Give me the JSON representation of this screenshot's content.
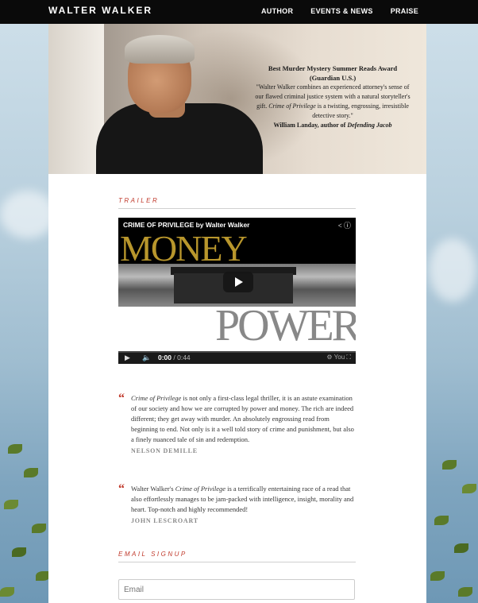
{
  "brand": "WALTER WALKER",
  "nav": [
    "AUTHOR",
    "EVENTS & NEWS",
    "PRAISE"
  ],
  "hero": {
    "award": "Best Murder Mystery Summer Reads Award (Guardian U.S.)",
    "quote_pre": "\"Walter Walker combines an experienced attorney's sense of our flawed criminal justice system with a natural storyteller's gift. ",
    "quote_book": "Crime of Privilege",
    "quote_post": " is a twisting, engrossing, irresistible detective story.\"",
    "attribution_pre": "William Landay, author of ",
    "attribution_book": "Defending Jacob"
  },
  "trailer": {
    "section_title": "TRAILER",
    "video_title": "CRIME OF PRIVILEGE by Walter Walker",
    "word_top": "MONEY",
    "word_bottom": "POWER",
    "time_current": "0:00",
    "time_sep": " / ",
    "time_total": "0:44",
    "progress": 0
  },
  "testimonials": [
    {
      "book": "Crime of Privilege",
      "text": " is not only a first-class legal thriller, it is an astute examination of our society and how we are corrupted by power and money. The rich are indeed different; they get away with murder. An absolutely engrossing read from beginning to end. Not only is it a well told story of crime and punishment, but also a finely nuanced tale of sin and redemption.",
      "author": "NELSON DEMILLE"
    },
    {
      "prefix": "Walter Walker's ",
      "book": "Crime of Privilege",
      "text": " is a terrifically entertaining race of a read that also effortlessly manages to be jam-packed with intelligence, insight, morality and heart. Top-notch and highly recommended!",
      "author": "JOHN LESCROART"
    }
  ],
  "email_signup": {
    "section_title": "EMAIL SIGNUP",
    "placeholder": "Email"
  },
  "colors": {
    "accent": "#c0392b",
    "topbar": "#0a0a0a"
  }
}
